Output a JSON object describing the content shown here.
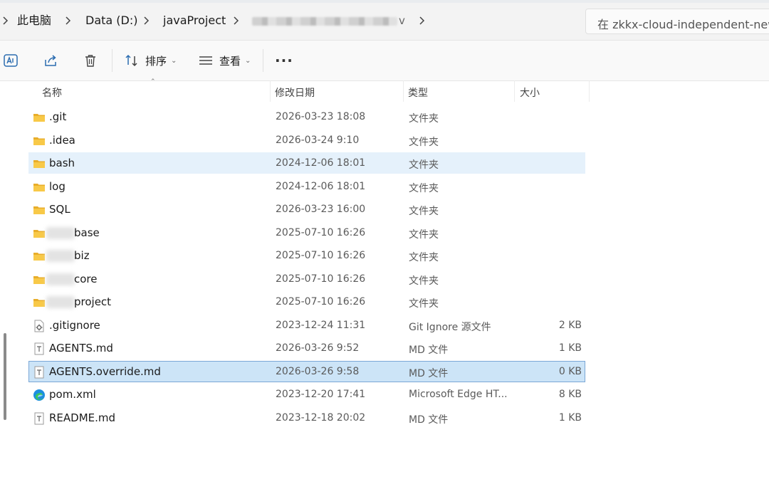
{
  "breadcrumb": {
    "items": [
      "此电脑",
      "Data (D:)",
      "javaProject"
    ],
    "tail": "v",
    "separator_icon": "chevron-right-icon"
  },
  "search": {
    "placeholder": "在 zkkx-cloud-independent-new 中"
  },
  "toolbar": {
    "sort_label": "排序",
    "view_label": "查看",
    "more_label": "···",
    "icons": [
      "ai-translate-icon",
      "share-icon",
      "delete-icon",
      "sort-icon",
      "view-icon",
      "more-icon"
    ]
  },
  "columns": {
    "name": "名称",
    "date": "修改日期",
    "type": "类型",
    "size": "大小"
  },
  "files": [
    {
      "name": ".git",
      "prefix_blurred": false,
      "date": "2026-03-23 18:08",
      "type": "文件夹",
      "size": "",
      "icon": "folder-icon",
      "state": ""
    },
    {
      "name": ".idea",
      "prefix_blurred": false,
      "date": "2026-03-24 9:10",
      "type": "文件夹",
      "size": "",
      "icon": "folder-icon",
      "state": ""
    },
    {
      "name": "bash",
      "prefix_blurred": false,
      "date": "2024-12-06 18:01",
      "type": "文件夹",
      "size": "",
      "icon": "folder-icon",
      "state": "hover"
    },
    {
      "name": "log",
      "prefix_blurred": false,
      "date": "2024-12-06 18:01",
      "type": "文件夹",
      "size": "",
      "icon": "folder-icon",
      "state": ""
    },
    {
      "name": "SQL",
      "prefix_blurred": false,
      "date": "2026-03-23 16:00",
      "type": "文件夹",
      "size": "",
      "icon": "folder-icon",
      "state": ""
    },
    {
      "name": "base",
      "prefix_blurred": true,
      "date": "2025-07-10 16:26",
      "type": "文件夹",
      "size": "",
      "icon": "folder-icon",
      "state": ""
    },
    {
      "name": "biz",
      "prefix_blurred": true,
      "date": "2025-07-10 16:26",
      "type": "文件夹",
      "size": "",
      "icon": "folder-icon",
      "state": ""
    },
    {
      "name": "core",
      "prefix_blurred": true,
      "date": "2025-07-10 16:26",
      "type": "文件夹",
      "size": "",
      "icon": "folder-icon",
      "state": ""
    },
    {
      "name": "project",
      "prefix_blurred": true,
      "date": "2025-07-10 16:26",
      "type": "文件夹",
      "size": "",
      "icon": "folder-icon",
      "state": ""
    },
    {
      "name": ".gitignore",
      "prefix_blurred": false,
      "date": "2023-12-24 11:31",
      "type": "Git Ignore 源文件",
      "size": "2 KB",
      "icon": "gear-file-icon",
      "state": ""
    },
    {
      "name": "AGENTS.md",
      "prefix_blurred": false,
      "date": "2026-03-26 9:52",
      "type": "MD 文件",
      "size": "1 KB",
      "icon": "text-file-icon",
      "state": ""
    },
    {
      "name": "AGENTS.override.md",
      "prefix_blurred": false,
      "date": "2026-03-26 9:58",
      "type": "MD 文件",
      "size": "0 KB",
      "icon": "text-file-icon",
      "state": "selected"
    },
    {
      "name": "pom.xml",
      "prefix_blurred": false,
      "date": "2023-12-20 17:41",
      "type": "Microsoft Edge HT...",
      "size": "8 KB",
      "icon": "edge-icon",
      "state": ""
    },
    {
      "name": "README.md",
      "prefix_blurred": false,
      "date": "2023-12-18 20:02",
      "type": "MD 文件",
      "size": "1 KB",
      "icon": "text-file-icon",
      "state": ""
    }
  ],
  "colors": {
    "folder": "#f8c948",
    "folder_dark": "#e8ad2a",
    "hover_row": "#e5f1fb",
    "selected_row": "#cce4f7",
    "selected_border": "#7aa7d6"
  }
}
